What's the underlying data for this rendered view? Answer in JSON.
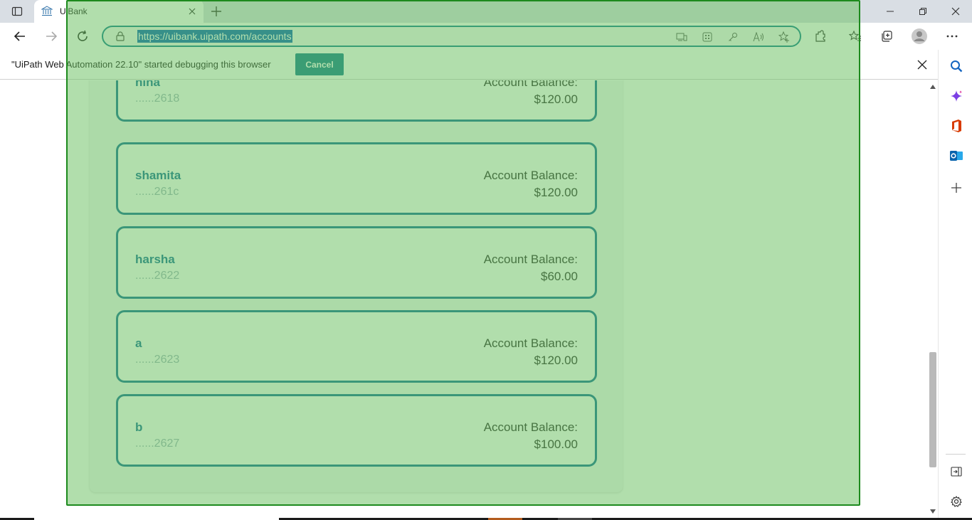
{
  "browser": {
    "tab_title": "UiBank",
    "url": "https://uibank.uipath.com/accounts",
    "infobar_message": "\"UiPath Web Automation 22.10\" started debugging this browser",
    "infobar_cancel": "Cancel"
  },
  "accounts": [
    {
      "name": "hina",
      "number": "......2618",
      "balance_label": "Account Balance:",
      "balance": "$120.00"
    },
    {
      "name": "shamita",
      "number": "......261c",
      "balance_label": "Account Balance:",
      "balance": "$120.00"
    },
    {
      "name": "harsha",
      "number": "......2622",
      "balance_label": "Account Balance:",
      "balance": "$60.00"
    },
    {
      "name": "a",
      "number": "......2623",
      "balance_label": "Account Balance:",
      "balance": "$120.00"
    },
    {
      "name": "b",
      "number": "......2627",
      "balance_label": "Account Balance:",
      "balance": "$100.00"
    }
  ],
  "colors": {
    "accent": "#126e99",
    "highlight": "#64be5a",
    "cancel_button": "#127c8e"
  }
}
